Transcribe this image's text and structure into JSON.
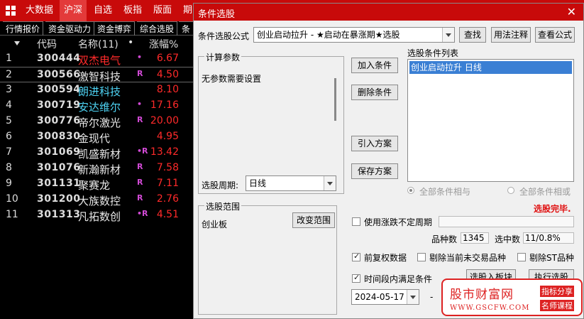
{
  "topbar": {
    "menus": [
      "大数据",
      "沪深",
      "自选",
      "板指",
      "版面",
      "期"
    ],
    "active": "沪深"
  },
  "subtabs": [
    "行情报价",
    "资金驱动力",
    "资金博弈",
    "综合选股",
    "条"
  ],
  "table": {
    "headers": {
      "code": "代码",
      "name": "名称(11)",
      "dot": "•",
      "change": "涨幅%"
    },
    "rows": [
      {
        "idx": "1",
        "code": "300444",
        "name": "双杰电气",
        "flag": "•",
        "change": "6.67",
        "name_color": "#ff2a2a"
      },
      {
        "idx": "2",
        "code": "300566",
        "name": "激智科技",
        "flag": "R",
        "change": "4.50",
        "name_color": "#e8e8e8"
      },
      {
        "idx": "3",
        "code": "300594",
        "name": "朗进科技",
        "flag": "",
        "change": "8.10",
        "name_color": "#4ed4f5"
      },
      {
        "idx": "4",
        "code": "300719",
        "name": "安达维尔",
        "flag": "•",
        "change": "17.16",
        "name_color": "#4ed4f5"
      },
      {
        "idx": "5",
        "code": "300776",
        "name": "帝尔激光",
        "flag": "R",
        "change": "20.00",
        "name_color": "#e8e8e8"
      },
      {
        "idx": "6",
        "code": "300830",
        "name": "金现代",
        "flag": "",
        "change": "4.95",
        "name_color": "#e8e8e8"
      },
      {
        "idx": "7",
        "code": "301069",
        "name": "凯盛新材",
        "flag": "•R",
        "change": "13.42",
        "name_color": "#e8e8e8"
      },
      {
        "idx": "8",
        "code": "301076",
        "name": "新瀚新材",
        "flag": "R",
        "change": "7.58",
        "name_color": "#e8e8e8"
      },
      {
        "idx": "9",
        "code": "301131",
        "name": "聚赛龙",
        "flag": "R",
        "change": "7.11",
        "name_color": "#e8e8e8"
      },
      {
        "idx": "10",
        "code": "301200",
        "name": "大族数控",
        "flag": "R",
        "change": "2.76",
        "name_color": "#e8e8e8"
      },
      {
        "idx": "11",
        "code": "301313",
        "name": "凡拓数创",
        "flag": "•R",
        "change": "4.51",
        "name_color": "#e8e8e8"
      }
    ]
  },
  "dialog": {
    "title": "条件选股",
    "close": "✕",
    "formula_label": "条件选股公式",
    "formula_value": "创业启动拉升 - ★启动在暴涨期★选股",
    "btn_search": "查找",
    "btn_usage": "用法注释",
    "btn_view": "查看公式",
    "params_title": "计算参数",
    "params_text": "无参数需要设置",
    "period_label": "选股周期:",
    "period_value": "日线",
    "btn_add": "加入条件",
    "btn_delete": "删除条件",
    "btn_import": "引入方案",
    "btn_save": "保存方案",
    "list_title": "选股条件列表",
    "list_items": [
      "创业启动拉升  日线"
    ],
    "radio_and": "全部条件相与",
    "radio_or": "全部条件相或",
    "status": "选股完毕.",
    "scope_title": "选股范围",
    "scope_value": "创业板",
    "btn_change_scope": "改变范围",
    "chk_variable_period": "使用涨跌不定周期",
    "count_label": "品种数",
    "count_value": "1345",
    "hit_label": "选中数",
    "hit_value": "11/0.8%",
    "chk_fq": "前复权数据",
    "chk_exclude_untraded": "剔除当前未交易品种",
    "chk_exclude_st": "剔除ST品种",
    "chk_time_range": "时间段内满足条件",
    "btn_to_block": "选股入板块",
    "btn_run": "执行选股",
    "date_value": "2024-05-17",
    "dash": "-"
  },
  "watermark": {
    "main": "股市财富网",
    "url": "WWW.GSCFW.COM",
    "badge1": "指标分享",
    "badge2": "名师课程"
  }
}
